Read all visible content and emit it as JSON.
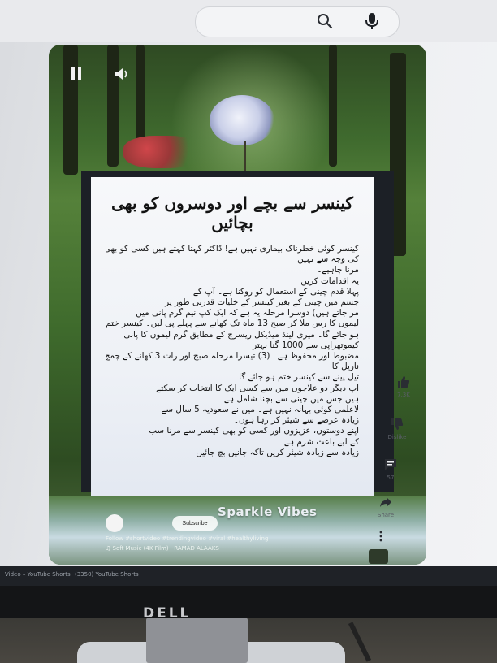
{
  "toolbar": {
    "search_icon": "search-icon",
    "mic_icon": "mic-icon"
  },
  "video": {
    "controls": {
      "pause_icon": "pause-icon",
      "volume_icon": "volume-icon"
    },
    "card": {
      "title": "کینسر سے بچے اور دوسروں کو بھی بچائیں",
      "lines": [
        "کینسر کوئی خطرناک بیماری نہیں ہے! ڈاکٹر کہتا کہتے ہیں کسی کو بھی کینسر",
        "کی وجہ سے نہیں",
        "مرنا چاہیے۔",
        "یہ اقدامات کریں",
        "پہلا قدم چینی کے استعمال کو روکنا ہے۔ آپ کے",
        "جسم میں چینی کے بغیر کینسر کے خلیات قدرتی طور پر",
        "مر جاتے ہیں) دوسرا مرحلہ یہ ہے کہ ایک کپ نیم گرم پانی میں",
        "لیموں کا رس ملا کر صبح 13 ماہ تک کھانے سے پہلے پی لیں۔ کینسر ختم",
        "ہو جائے گا۔ میری لینڈ میڈیکل ریسرچ کے مطابق گرم لیموں کا پانی",
        "کیموتھراپی سے 1000 گنا بہتر",
        "مضبوط اور محفوظ ہے۔ (3) تیسرا مرحلہ صبح اور رات 3 کھانے کے چمچ",
        "ناریل کا",
        "تیل پینے سے کینسر ختم ہو جائے گا۔",
        "آپ دیگر دو علاجوں میں سے کسی ایک کا انتخاب کر سکتے",
        "ہیں جس میں چینی سے بچنا شامل ہے۔",
        "لاعلمی کوئی بہانہ نہیں ہے۔ میں نے سعودیہ 5 سال سے",
        "زیادہ عرصے سے شیئر کر رہا ہوں۔",
        "اپنے دوستوں، عزیزوں اور کسی کو بھی کینسر سے مرنا سب",
        "کے لیے باعث شرم ہے۔",
        "زیادہ سے زیادہ شیئر کریں تاکہ جانیں بچ جائیں"
      ]
    },
    "channel": {
      "subscribe_label": "Subscribe",
      "name": "Sparkle Vibes",
      "caption": "Follow #shortvideo #trendingvideo #viral #healthyliving",
      "music": "♫ Soft Music (4K Film) · RAMAD ALAAKS"
    }
  },
  "actions": {
    "like": {
      "icon": "thumbs-up-icon",
      "label": "7.3K"
    },
    "dislike": {
      "icon": "thumbs-down-icon",
      "label": "Dislike"
    },
    "comments": {
      "icon": "comment-icon",
      "label": "57"
    },
    "share": {
      "icon": "share-icon",
      "label": "Share"
    },
    "more": {
      "icon": "more-vert-icon"
    }
  },
  "taskbar": {
    "items": [
      "Video – YouTube Shorts",
      "(3350) YouTube Shorts"
    ]
  },
  "monitor": {
    "brand": "DELL"
  }
}
